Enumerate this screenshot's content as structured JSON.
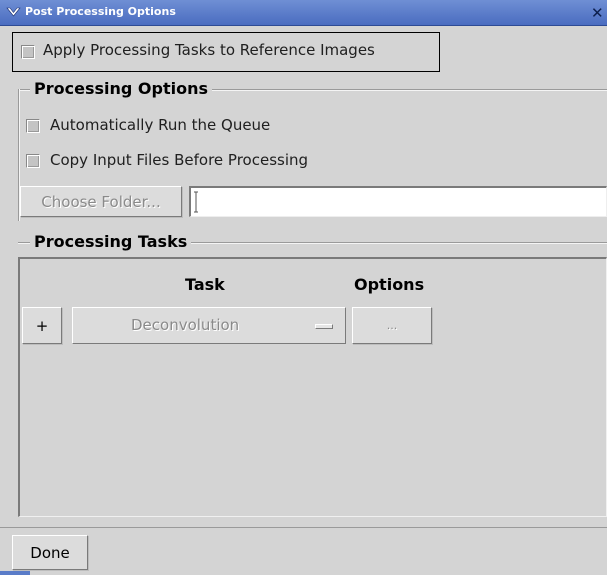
{
  "window": {
    "title": "Post Processing Options",
    "menu_icon": "chevron-down-icon",
    "close_icon": "close-icon",
    "close_glyph": "✕"
  },
  "apply_reference": {
    "label": "Apply Processing Tasks to Reference Images",
    "checked": false
  },
  "processing_options": {
    "title": "Processing Options",
    "auto_run": {
      "label": "Automatically Run the Queue",
      "checked": false
    },
    "copy_input": {
      "label": "Copy Input Files Before Processing",
      "checked": false
    },
    "choose_folder_label": "Choose Folder...",
    "folder_path_value": ""
  },
  "processing_tasks": {
    "title": "Processing Tasks",
    "columns": {
      "task": "Task",
      "options": "Options"
    },
    "rows": [
      {
        "add_label": "+",
        "task": "Deconvolution",
        "options_label": "..."
      }
    ]
  },
  "footer": {
    "done_label": "Done"
  },
  "colors": {
    "titlebar": "#5a7cc8",
    "background": "#d4d4d4"
  }
}
